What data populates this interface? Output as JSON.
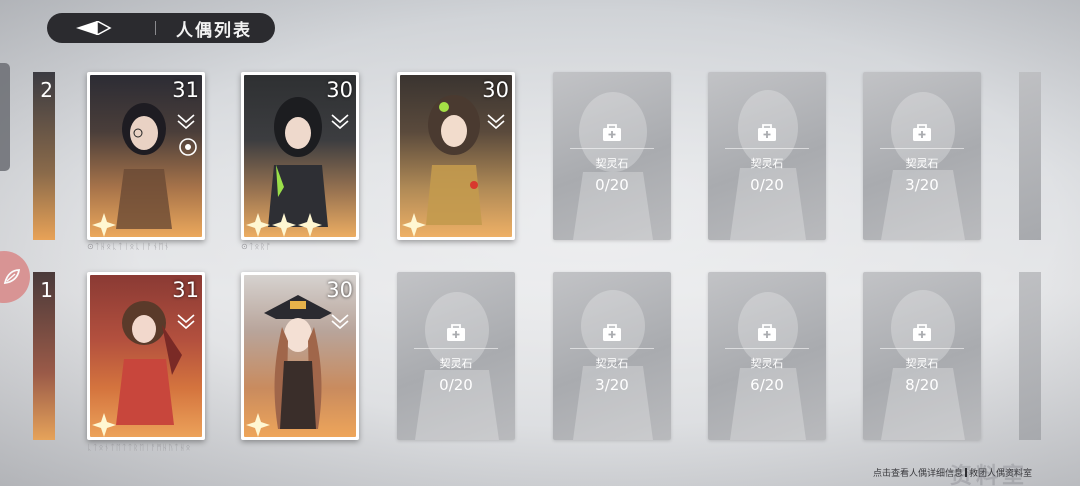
{
  "header": {
    "title": "人偶列表",
    "back_icon": "diamond-back-icon"
  },
  "colors": {
    "header_bg": "#2b2b2f",
    "owned_gradient_top": "#3a3a40",
    "owned_gradient_bottom": "#e9a45a",
    "locked_bg": "#b3b4b8",
    "star": "#fff7d2"
  },
  "owned_dolls": [
    {
      "level": "31",
      "stars": 1,
      "rank_icon": "rank-chevron-icon",
      "extra_icon": "moon-badge-icon"
    },
    {
      "level": "30",
      "stars": 3,
      "rank_icon": "rank-chevron-icon"
    },
    {
      "level": "30",
      "stars": 1,
      "rank_icon": "rank-chevron-icon"
    },
    {
      "level": "31",
      "stars": 1,
      "rank_icon": "rank-chevron-icon"
    },
    {
      "level": "30",
      "stars": 1,
      "rank_icon": "rank-chevron-icon"
    }
  ],
  "locked_dolls": [
    {
      "item": "契灵石",
      "progress": "0/20"
    },
    {
      "item": "契灵石",
      "progress": "0/20"
    },
    {
      "item": "契灵石",
      "progress": "3/20"
    },
    {
      "item": "契灵石",
      "progress": "0/20"
    },
    {
      "item": "契灵石",
      "progress": "3/20"
    },
    {
      "item": "契灵石",
      "progress": "6/20"
    },
    {
      "item": "契灵石",
      "progress": "8/20"
    }
  ],
  "edge_levels": [
    "2",
    "1"
  ],
  "footer": {
    "hint": "点击查看人偶详细信息",
    "location": "救团人偶资料室"
  }
}
